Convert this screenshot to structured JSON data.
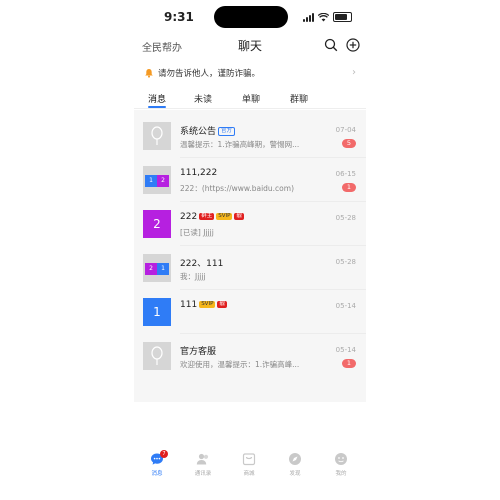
{
  "status": {
    "time": "9:31"
  },
  "nav": {
    "left": "全民帮办",
    "title": "聊天"
  },
  "notice": {
    "text": "请勿告诉他人，谨防诈骗。"
  },
  "tabs": [
    {
      "label": "消息"
    },
    {
      "label": "未读"
    },
    {
      "label": "单聊"
    },
    {
      "label": "群聊"
    }
  ],
  "chats": [
    {
      "name": "系统公告",
      "tag": "官方",
      "preview": "温馨提示：1.诈骗高峰期，警惕网...",
      "date": "07-04",
      "badge": "5"
    },
    {
      "name": "111,222",
      "preview": "222：(https://www.baidu.com)",
      "date": "06-15",
      "badge": "1",
      "avatar_left": "1",
      "avatar_right": "2"
    },
    {
      "name": "222",
      "tag_red": "群主",
      "tag_vip": "SVIP",
      "tag_red2": "靓",
      "avatar": "2",
      "preview": "[已读] Jjjjj",
      "date": "05-28"
    },
    {
      "name": "222、111",
      "preview": "我：Jjjjj",
      "date": "05-28",
      "avatar_left": "2",
      "avatar_right": "1"
    },
    {
      "name": "111",
      "tag_vip": "SVIP",
      "tag_red2": "靓",
      "avatar": "1",
      "date": "05-14"
    },
    {
      "name": "官方客服",
      "preview": "欢迎使用，温馨提示：1.诈骗高峰...",
      "date": "05-14",
      "badge": "1"
    }
  ],
  "bottom_nav": [
    {
      "label": "消息",
      "badge": "7"
    },
    {
      "label": "通讯录"
    },
    {
      "label": "商城"
    },
    {
      "label": "发现"
    },
    {
      "label": "我的"
    }
  ],
  "colors": {
    "accent": "#2f7cf6",
    "badge": "#f26a6a",
    "purple": "#b620e0"
  }
}
